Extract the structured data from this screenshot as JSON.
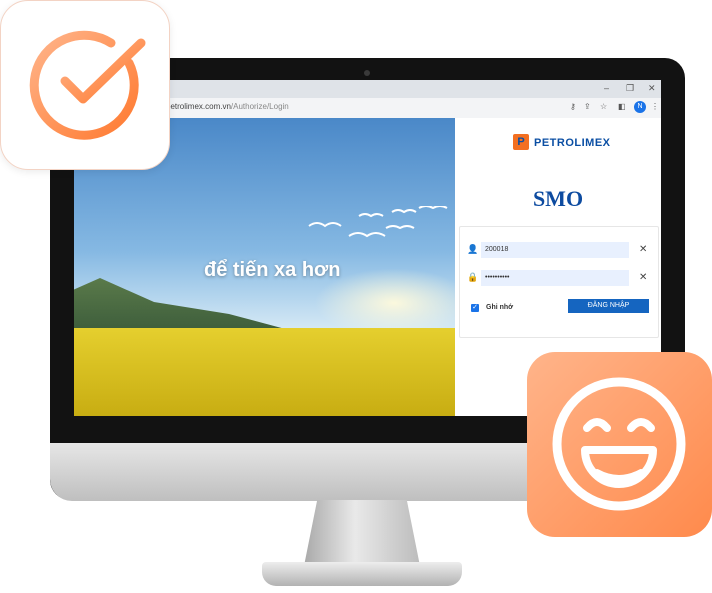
{
  "browser": {
    "url_domain": "petrolimex.com.vn",
    "url_path": "/Authorize/Login",
    "profile_initial": "N",
    "window_controls": [
      "–",
      "❐",
      "✕"
    ]
  },
  "hero": {
    "tagline": "để tiến xa hơn"
  },
  "login": {
    "brand": "PETROLIMEX",
    "logo_mark": "P",
    "app_title": "SMO",
    "username_value": "200018",
    "password_value": "••••••••••",
    "remember_label": "Ghi nhớ",
    "submit_label": "ĐĂNG NHẬP"
  },
  "colors": {
    "brand_blue": "#0a4ea3",
    "brand_orange": "#f36f21",
    "badge_orange": "#ff8a4c"
  },
  "icons": [
    "check-circle-icon",
    "smile-face-icon",
    "user-icon",
    "lock-icon",
    "close-icon",
    "key-icon",
    "share-icon",
    "star-icon",
    "sidebar-icon",
    "more-vert-icon"
  ]
}
